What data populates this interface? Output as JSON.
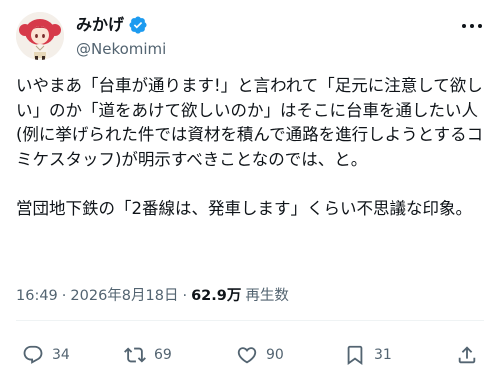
{
  "author": {
    "display_name": "みかげ",
    "handle": "@Nekomimi",
    "verified": true,
    "avatar_icon": "anime-avatar-red-hair",
    "accent_color": "#1d9bf0"
  },
  "tweet": {
    "text": "いやまあ「台車が通ります!」と言われて「足元に注意して欲しい」のか「道をあけて欲しいのか」はそこに台車を通したい人(例に挙げられた件では資材を積んで通路を進行しようとするコミケスタッフ)が明示すべきことなのでは、と。\n\n営団地下鉄の「2番線は、発車します」くらい不思議な印象。"
  },
  "meta": {
    "time": "16:49",
    "separator": "·",
    "date": "2026年8月18日",
    "separator2": "·",
    "views_count": "62.9万",
    "views_label": "再生数"
  },
  "actions": {
    "reply": {
      "icon": "reply-icon",
      "count": "34"
    },
    "retweet": {
      "icon": "retweet-icon",
      "count": "69"
    },
    "like": {
      "icon": "heart-icon",
      "count": "90"
    },
    "bookmark": {
      "icon": "bookmark-icon",
      "count": "31"
    },
    "share": {
      "icon": "share-icon"
    }
  }
}
